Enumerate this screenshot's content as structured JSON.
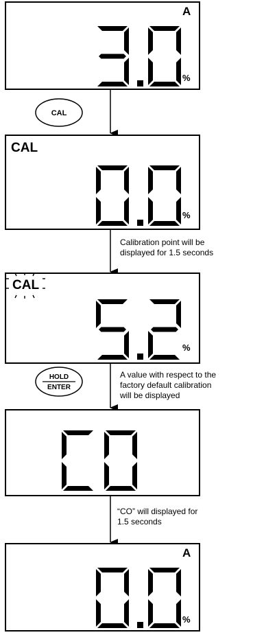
{
  "screens": [
    {
      "id": "screen-1",
      "top_label": "",
      "corner_label": "A",
      "digits": "3.0",
      "unit": "%",
      "cal_blink": false
    },
    {
      "id": "screen-2",
      "top_label": "CAL",
      "corner_label": "",
      "digits": "0.0",
      "unit": "%",
      "cal_blink": false
    },
    {
      "id": "screen-3",
      "top_label": "CAL",
      "corner_label": "",
      "digits": "5.2",
      "unit": "%",
      "cal_blink": true
    },
    {
      "id": "screen-4",
      "top_label": "",
      "corner_label": "",
      "digits": "CO",
      "unit": "",
      "cal_blink": false
    },
    {
      "id": "screen-5",
      "top_label": "",
      "corner_label": "A",
      "digits": "0.0",
      "unit": "%",
      "cal_blink": false
    }
  ],
  "buttons": {
    "cal": "CAL",
    "hold": "HOLD",
    "enter": "ENTER"
  },
  "notes": {
    "step2": [
      "Calibration point  will be",
      "displayed for 1.5 seconds"
    ],
    "step3": [
      "A value with respect to the",
      "factory default calibration",
      "will be displayed"
    ],
    "step4": [
      "“CO” will displayed for",
      "1.5 seconds"
    ]
  },
  "colors": {
    "ink": "#000000",
    "background": "#ffffff"
  }
}
